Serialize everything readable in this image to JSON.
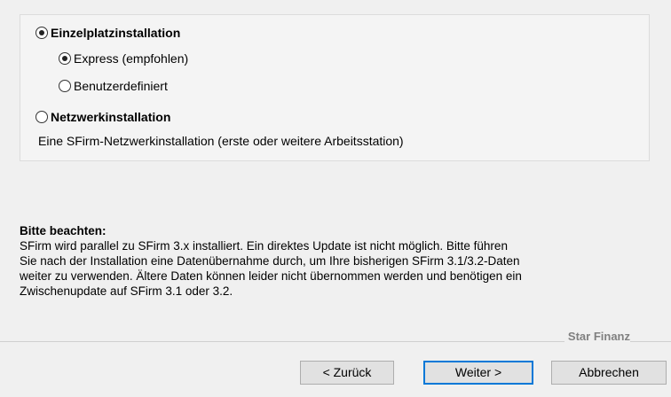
{
  "install_options": {
    "single": {
      "label": "Einzelplatzinstallation",
      "checked": true
    },
    "express": {
      "label": "Express (empfohlen)",
      "checked": true
    },
    "custom": {
      "label": "Benutzerdefiniert",
      "checked": false
    },
    "network": {
      "label": "Netzwerkinstallation",
      "checked": false,
      "description": "Eine SFirm-Netzwerkinstallation (erste oder weitere Arbeitsstation)"
    }
  },
  "note": {
    "title": "Bitte beachten:",
    "lines": [
      "SFirm wird parallel zu SFirm 3.x installiert. Ein direktes Update ist nicht möglich. Bitte führen",
      "Sie nach der Installation eine Datenübernahme durch, um Ihre bisherigen SFirm 3.1/3.2-Daten",
      "weiter zu verwenden. Ältere Daten können leider nicht übernommen werden und benötigen ein",
      "Zwischenupdate auf SFirm 3.1 oder 3.2."
    ]
  },
  "brand": "Star Finanz",
  "buttons": {
    "back": "< Zurück",
    "next": "Weiter >",
    "cancel": "Abbrechen"
  }
}
